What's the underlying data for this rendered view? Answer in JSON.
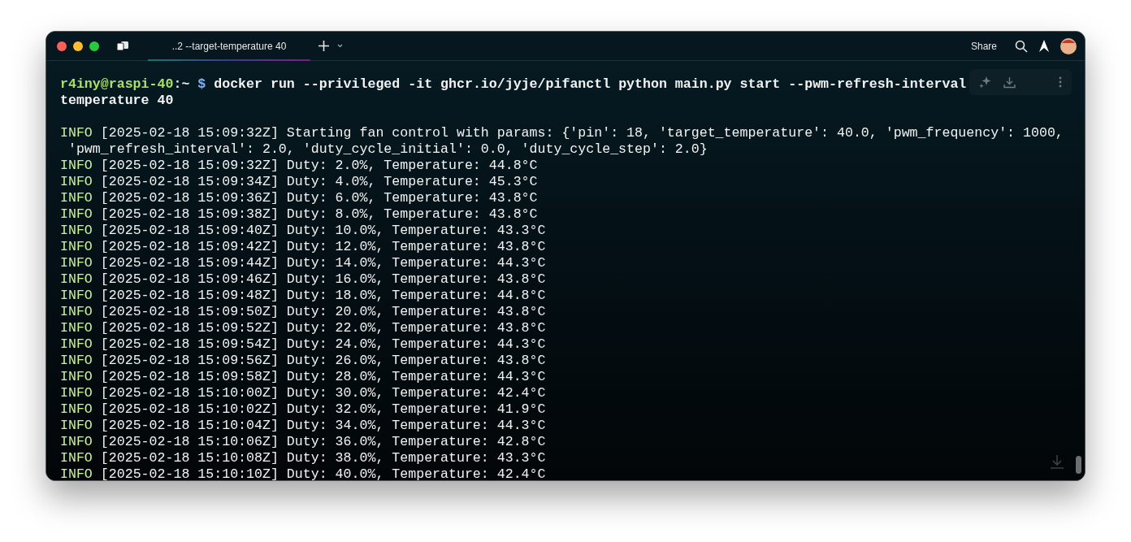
{
  "title_bar": {
    "tabs": [
      {
        "label": "..2 --target-temperature 40",
        "selected": true
      }
    ],
    "share_label": "Share"
  },
  "terminal": {
    "prompt": {
      "user_host": "r4iny@raspi-40",
      "path": ":~",
      "symbol": "$"
    },
    "command": "docker run --privileged -it ghcr.io/jyje/pifanctl python main.py start --pwm-refresh-interval",
    "command_wrap": "temperature 40",
    "logs": [
      {
        "level": "INFO",
        "message": "[2025-02-18 15:09:32Z] Starting fan control with params: {'pin': 18, 'target_temperature': 40.0, 'pwm_frequency': 1000,",
        "continuation": " 'pwm_refresh_interval': 2.0, 'duty_cycle_initial': 0.0, 'duty_cycle_step': 2.0}"
      },
      {
        "level": "INFO",
        "message": "[2025-02-18 15:09:32Z] Duty: 2.0%, Temperature: 44.8°C"
      },
      {
        "level": "INFO",
        "message": "[2025-02-18 15:09:34Z] Duty: 4.0%, Temperature: 45.3°C"
      },
      {
        "level": "INFO",
        "message": "[2025-02-18 15:09:36Z] Duty: 6.0%, Temperature: 43.8°C"
      },
      {
        "level": "INFO",
        "message": "[2025-02-18 15:09:38Z] Duty: 8.0%, Temperature: 43.8°C"
      },
      {
        "level": "INFO",
        "message": "[2025-02-18 15:09:40Z] Duty: 10.0%, Temperature: 43.3°C"
      },
      {
        "level": "INFO",
        "message": "[2025-02-18 15:09:42Z] Duty: 12.0%, Temperature: 43.8°C"
      },
      {
        "level": "INFO",
        "message": "[2025-02-18 15:09:44Z] Duty: 14.0%, Temperature: 44.3°C"
      },
      {
        "level": "INFO",
        "message": "[2025-02-18 15:09:46Z] Duty: 16.0%, Temperature: 43.8°C"
      },
      {
        "level": "INFO",
        "message": "[2025-02-18 15:09:48Z] Duty: 18.0%, Temperature: 44.8°C"
      },
      {
        "level": "INFO",
        "message": "[2025-02-18 15:09:50Z] Duty: 20.0%, Temperature: 43.8°C"
      },
      {
        "level": "INFO",
        "message": "[2025-02-18 15:09:52Z] Duty: 22.0%, Temperature: 43.8°C"
      },
      {
        "level": "INFO",
        "message": "[2025-02-18 15:09:54Z] Duty: 24.0%, Temperature: 44.3°C"
      },
      {
        "level": "INFO",
        "message": "[2025-02-18 15:09:56Z] Duty: 26.0%, Temperature: 43.8°C"
      },
      {
        "level": "INFO",
        "message": "[2025-02-18 15:09:58Z] Duty: 28.0%, Temperature: 44.3°C"
      },
      {
        "level": "INFO",
        "message": "[2025-02-18 15:10:00Z] Duty: 30.0%, Temperature: 42.4°C"
      },
      {
        "level": "INFO",
        "message": "[2025-02-18 15:10:02Z] Duty: 32.0%, Temperature: 41.9°C"
      },
      {
        "level": "INFO",
        "message": "[2025-02-18 15:10:04Z] Duty: 34.0%, Temperature: 44.3°C"
      },
      {
        "level": "INFO",
        "message": "[2025-02-18 15:10:06Z] Duty: 36.0%, Temperature: 42.8°C"
      },
      {
        "level": "INFO",
        "message": "[2025-02-18 15:10:08Z] Duty: 38.0%, Temperature: 43.3°C"
      },
      {
        "level": "INFO",
        "message": "[2025-02-18 15:10:10Z] Duty: 40.0%, Temperature: 42.4°C"
      }
    ]
  }
}
